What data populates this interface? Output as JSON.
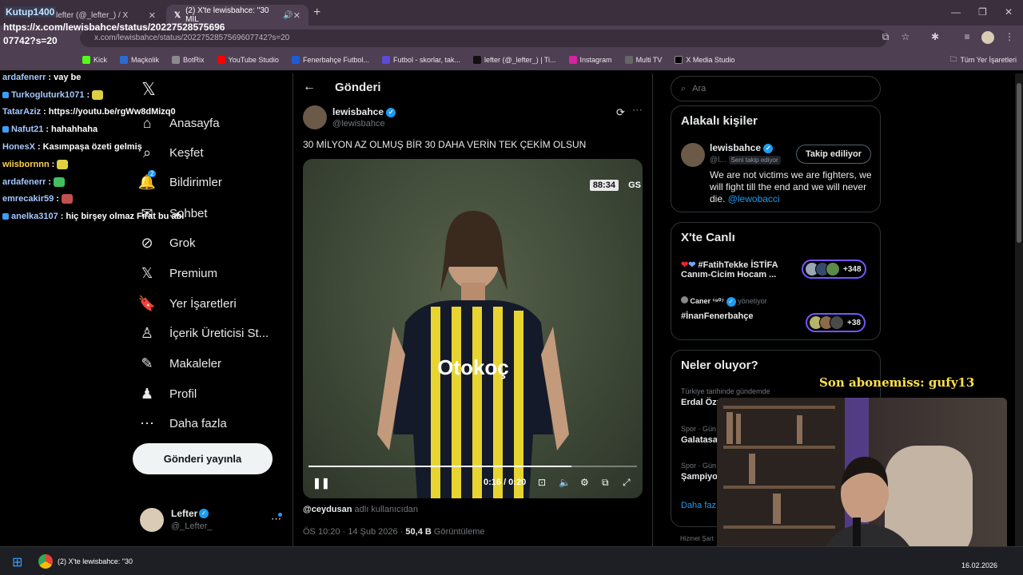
{
  "browser": {
    "tabs": [
      {
        "label": "lefter (@_lefter_) / X"
      },
      {
        "label": "(2) X'te lewisbahce: \"30 MİL"
      }
    ],
    "url": "x.com/lewisbahce/status/2022752857569607742?s=20",
    "bookmarks": [
      "Kick",
      "Maçkolik",
      "BotRix",
      "YouTube Studio",
      "Fenerbahçe Futbol...",
      "Futbol - skorlar, tak...",
      "lefter (@_lefter_) | Ti...",
      "Instagram",
      "Multi TV",
      "X Media Studio"
    ],
    "all_bookmarks": "Tüm Yer İşaretleri"
  },
  "stream_overlay": {
    "title": "Kutup1400",
    "url_text": "https://x.com/lewisbahce/status/2022752857569607742?s=20",
    "chat": [
      {
        "user": "ardafenerr",
        "msg": "vay be",
        "badge": false,
        "yellow": false
      },
      {
        "user": "Turkogluturk1071",
        "msg": "",
        "badge": true,
        "yellow": false
      },
      {
        "user": "TatarAziz",
        "msg": "https://youtu.be/rgWw8dMizq0",
        "badge": false,
        "yellow": false
      },
      {
        "user": "Nafut21",
        "msg": "hahahhaha",
        "badge": true,
        "yellow": false
      },
      {
        "user": "HonesX",
        "msg": "Kasımpaşa özeti gelmiş",
        "badge": false,
        "yellow": false
      },
      {
        "user": "wiisbornnn",
        "msg": "",
        "badge": false,
        "yellow": true
      },
      {
        "user": "ardafenerr",
        "msg": "",
        "badge": false,
        "yellow": false
      },
      {
        "user": "emrecakir59",
        "msg": "",
        "badge": false,
        "yellow": false
      },
      {
        "user": "anelka3107",
        "msg": "hiç birşey olmaz Fırat bu abi",
        "badge": true,
        "yellow": false
      }
    ]
  },
  "nav": {
    "items": [
      {
        "label": "Anasayfa",
        "icon": "home-icon"
      },
      {
        "label": "Keşfet",
        "icon": "search-icon"
      },
      {
        "label": "Bildirimler",
        "icon": "bell-icon"
      },
      {
        "label": "Sohbet",
        "icon": "chat-icon"
      },
      {
        "label": "Grok",
        "icon": "grok-icon"
      },
      {
        "label": "Premium",
        "icon": "x-icon"
      },
      {
        "label": "Yer İşaretleri",
        "icon": "bookmark-icon"
      },
      {
        "label": "İçerik Üreticisi St...",
        "icon": "creator-icon"
      },
      {
        "label": "Makaleler",
        "icon": "article-icon"
      },
      {
        "label": "Profil",
        "icon": "person-icon"
      },
      {
        "label": "Daha fazla",
        "icon": "more-icon"
      }
    ],
    "notification_count": "2",
    "post_button": "Gönderi yayınla",
    "account": {
      "name": "Lefter",
      "handle": "@_Lefter_"
    }
  },
  "post": {
    "header": "Gönderi",
    "author_name": "lewisbahce",
    "author_handle": "@lewisbahce",
    "text": "30 MİLYON AZ OLMUŞ BİR 30 DAHA VERİN TEK ÇEKİM OLSUN",
    "video": {
      "score_clock": "88:34",
      "score_team": "GS",
      "time": "0:16 / 0:20",
      "progress": 0.8,
      "shirt_sponsor": "Otokoç"
    },
    "credit_user": "@ceydusan",
    "credit_suffix": "adlı kullanıcıdan",
    "timestamp": "ÖS 10:20 · 14 Şub 2026 · ",
    "views": "50,4 B",
    "views_label": "Görüntüleme"
  },
  "right": {
    "search_placeholder": "Ara",
    "relevant_title": "Alakalı kişiler",
    "relevant_user": {
      "name": "lewisbahce",
      "handle": "@l...",
      "follows_you": "Seni takip ediyor",
      "follow_button": "Takip ediliyor",
      "bio": "We are not victims we are fighters, we will fight till the end and we will never die.",
      "bio_link": "@lewobacci"
    },
    "live_title": "X'te Canlı",
    "live": [
      {
        "title": "#FatihTekke İSTİFA",
        "subtitle": "Canım-Cicim Hocam ...",
        "count": "+348"
      },
      {
        "host": "Caner ¹⁹⁰⁷",
        "host_suffix": "yönetiyor",
        "title": "#İnanFenerbahçe",
        "count": "+38"
      }
    ],
    "whats_title": "Neler oluyor?",
    "trends": [
      {
        "context": "Türkiye tarihinde gündemde",
        "name": "Erdal Özy"
      },
      {
        "context": "Spor · Gün",
        "name": "Galatasa"
      },
      {
        "context": "Spor · Gün",
        "name": "Şampiyo"
      }
    ],
    "more_link": "Daha faz",
    "footer": "Hizmet Şart"
  },
  "webcam": {
    "subscriber_banner": "Son abonemiss: gufy13"
  },
  "taskbar": {
    "app_label": "(2) X'te lewisbahce: \"30",
    "date": "16.02.2026"
  }
}
